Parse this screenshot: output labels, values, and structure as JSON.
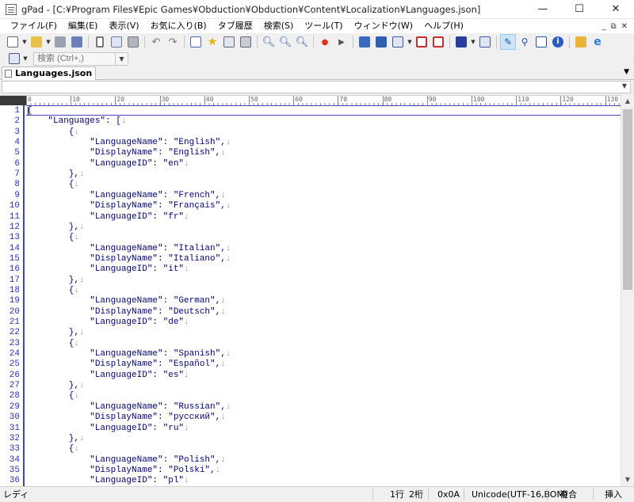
{
  "titlebar": {
    "title": "gPad - [C:¥Program Files¥Epic Games¥Obduction¥Obduction¥Content¥Localization¥Languages.json]",
    "min": "—",
    "max": "☐",
    "close": "✕"
  },
  "menu": {
    "items": [
      "ファイル(F)",
      "編集(E)",
      "表示(V)",
      "お気に入り(B)",
      "タブ履歴",
      "検索(S)",
      "ツール(T)",
      "ウィンドウ(W)",
      "ヘルプ(H)"
    ],
    "mdi_min": "_",
    "mdi_restore": "⧉",
    "mdi_close": "✕"
  },
  "search": {
    "placeholder": "検索 (Ctrl+,)"
  },
  "tabs": {
    "active": "Languages.json",
    "menu_arrow": "▼"
  },
  "combo": {
    "arrow": "▼"
  },
  "ruler": {
    "labels": [
      "0",
      "10",
      "20",
      "30",
      "40",
      "50",
      "60",
      "70",
      "80",
      "90",
      "100",
      "110",
      "120",
      "130"
    ]
  },
  "editor": {
    "line_numbers": [
      "1",
      "2",
      "3",
      "4",
      "5",
      "6",
      "7",
      "8",
      "9",
      "10",
      "11",
      "12",
      "13",
      "14",
      "15",
      "16",
      "17",
      "18",
      "19",
      "20",
      "21",
      "22",
      "23",
      "24",
      "25",
      "26",
      "27",
      "28",
      "29",
      "30",
      "31",
      "32",
      "33",
      "34",
      "35",
      "36"
    ],
    "lines": [
      "{",
      "    \"Languages\": [",
      "        {",
      "            \"LanguageName\": \"English\",",
      "            \"DisplayName\": \"English\",",
      "            \"LanguageID\": \"en\"",
      "        },",
      "        {",
      "            \"LanguageName\": \"French\",",
      "            \"DisplayName\": \"Français\",",
      "            \"LanguageID\": \"fr\"",
      "        },",
      "        {",
      "            \"LanguageName\": \"Italian\",",
      "            \"DisplayName\": \"Italiano\",",
      "            \"LanguageID\": \"it\"",
      "        },",
      "        {",
      "            \"LanguageName\": \"German\",",
      "            \"DisplayName\": \"Deutsch\",",
      "            \"LanguageID\": \"de\"",
      "        },",
      "        {",
      "            \"LanguageName\": \"Spanish\",",
      "            \"DisplayName\": \"Español\",",
      "            \"LanguageID\": \"es\"",
      "        },",
      "        {",
      "            \"LanguageName\": \"Russian\",",
      "            \"DisplayName\": \"русский\",",
      "            \"LanguageID\": \"ru\"",
      "        },",
      "        {",
      "            \"LanguageName\": \"Polish\",",
      "            \"DisplayName\": \"Polski\",",
      "            \"LanguageID\": \"pl\""
    ],
    "newline_mark": "↓"
  },
  "scrollbar": {
    "up": "▲",
    "down": "▼"
  },
  "status": {
    "mode": "レディ",
    "line": "1行",
    "col": "2桁",
    "char_code": "0x0A",
    "encoding": "Unicode(UTF-16,BOM)",
    "linefeed": "複合",
    "insert": "挿入"
  },
  "colors": {
    "code_text": "#000080",
    "line_numbers": "#2c2cc8",
    "newline_mark": "#999999"
  }
}
